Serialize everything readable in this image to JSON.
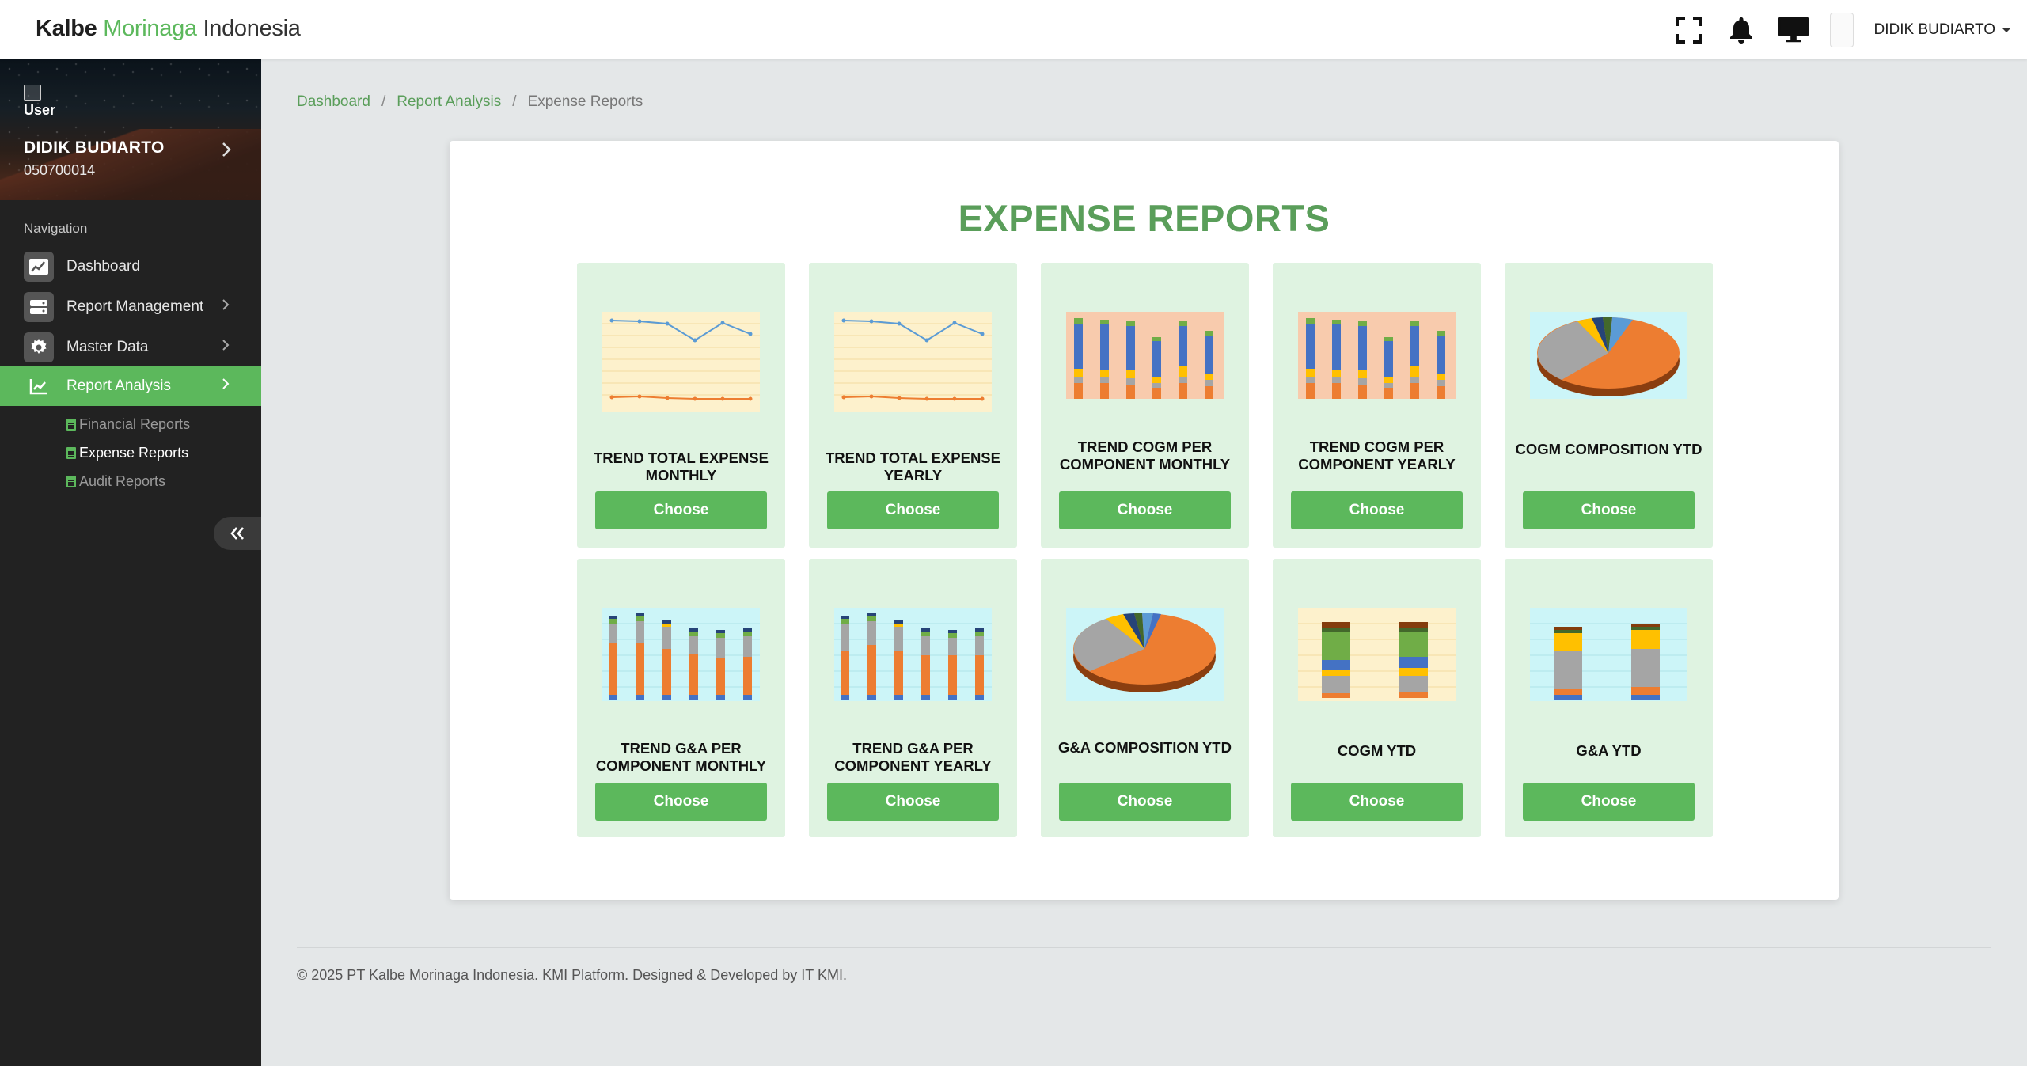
{
  "brand": {
    "part1": "Kalbe",
    "part2": "Morinaga",
    "part3": "Indonesia"
  },
  "header": {
    "user_name": "DIDIK BUDIARTO",
    "icons": [
      "fullscreen-icon",
      "bell-icon",
      "monitor-icon",
      "user-avatar-icon"
    ]
  },
  "sidebar": {
    "user_image_alt": "User",
    "user_name": "DIDIK BUDIARTO",
    "user_id": "050700014",
    "nav_title": "Navigation",
    "items": [
      {
        "label": "Dashboard",
        "icon": "chart-line-icon"
      },
      {
        "label": "Report Management",
        "icon": "server-icon"
      },
      {
        "label": "Master Data",
        "icon": "gear-icon"
      },
      {
        "label": "Report Analysis",
        "icon": "chart-area-icon",
        "active": true
      }
    ],
    "sub_items": [
      {
        "label": "Financial Reports"
      },
      {
        "label": "Expense Reports",
        "active": true
      },
      {
        "label": "Audit Reports"
      }
    ]
  },
  "breadcrumb": {
    "items": [
      "Dashboard",
      "Report Analysis",
      "Expense Reports"
    ],
    "separator": "/"
  },
  "page_title": "EXPENSE REPORTS",
  "tiles": [
    {
      "label": "TREND TOTAL EXPENSE MONTHLY",
      "button": "Choose",
      "thumbnail": "line-chart"
    },
    {
      "label": "TREND TOTAL EXPENSE YEARLY",
      "button": "Choose",
      "thumbnail": "line-chart"
    },
    {
      "label": "TREND COGM PER COMPONENT MONTHLY",
      "button": "Choose",
      "thumbnail": "stacked-bar-chart"
    },
    {
      "label": "TREND COGM PER COMPONENT YEARLY",
      "button": "Choose",
      "thumbnail": "stacked-bar-chart"
    },
    {
      "label": "COGM COMPOSITION YTD",
      "button": "Choose",
      "thumbnail": "pie-chart"
    },
    {
      "label": "TREND G&A PER COMPONENT MONTHLY",
      "button": "Choose",
      "thumbnail": "stacked-bar-chart"
    },
    {
      "label": "TREND G&A PER COMPONENT YEARLY",
      "button": "Choose",
      "thumbnail": "stacked-bar-chart"
    },
    {
      "label": "G&A COMPOSITION YTD",
      "button": "Choose",
      "thumbnail": "pie-chart"
    },
    {
      "label": "COGM YTD",
      "button": "Choose",
      "thumbnail": "stacked-bar-chart"
    },
    {
      "label": "G&A YTD",
      "button": "Choose",
      "thumbnail": "stacked-bar-chart"
    }
  ],
  "footer": "© 2025 PT Kalbe Morinaga Indonesia. KMI Platform. Designed & Developed by IT KMI.",
  "colors": {
    "accent": "#5cb85c",
    "title": "#5a9e5a",
    "tile_bg": "#dff3e1",
    "sidebar_bg": "#222222"
  }
}
